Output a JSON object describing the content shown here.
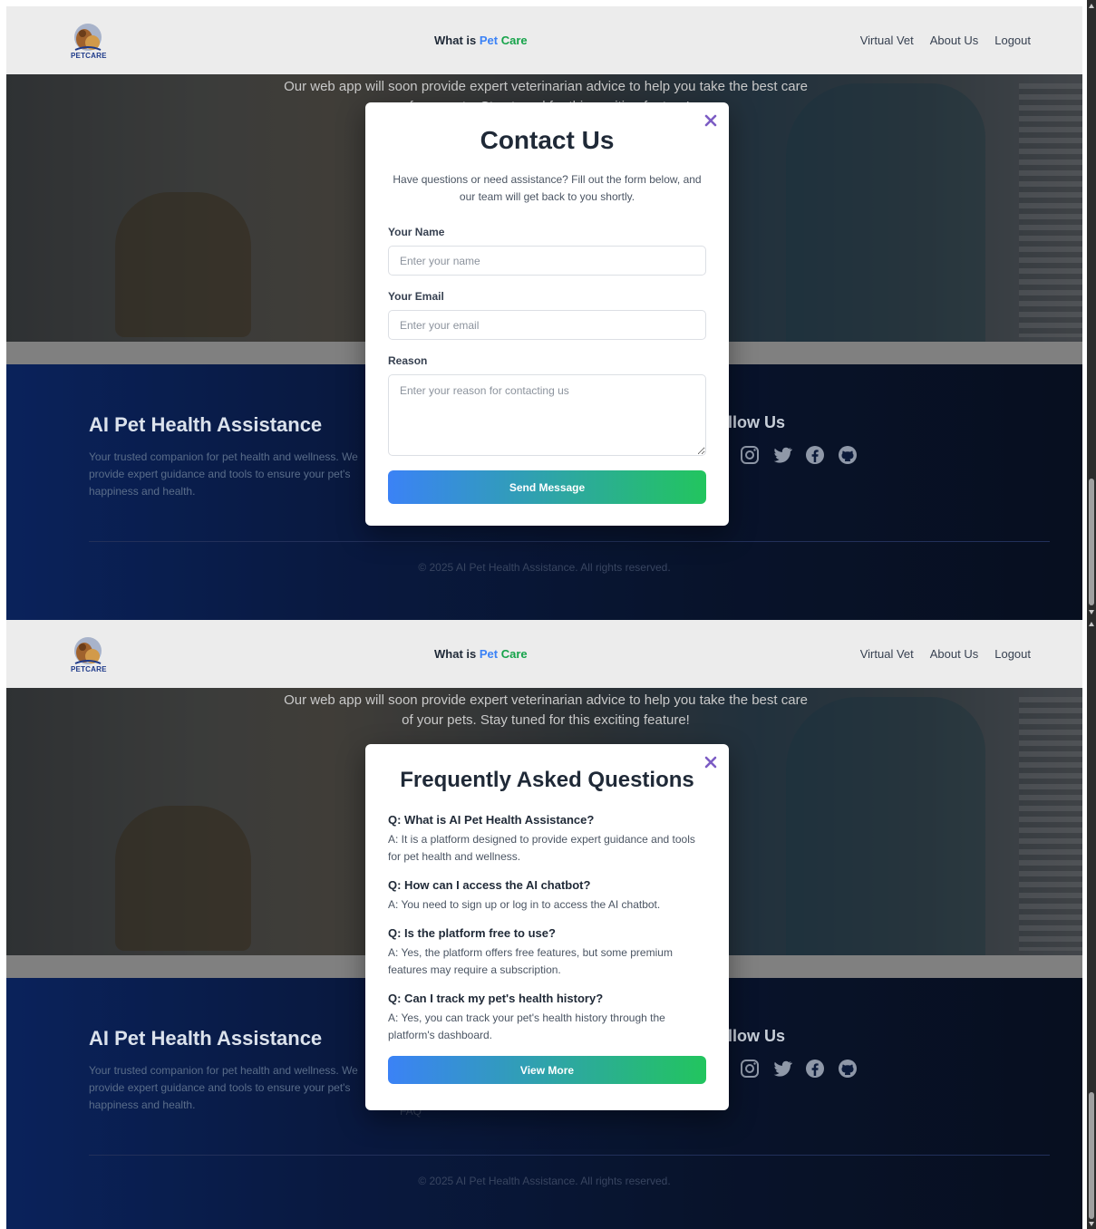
{
  "nav": {
    "logo_text": "PETCARE",
    "center_prefix": "What is ",
    "center_accent": "Pet",
    "center_accent2": "Care",
    "links": [
      "Virtual Vet",
      "About Us",
      "Logout"
    ]
  },
  "hero": {
    "text": "Our web app will soon provide expert veterinarian advice to help you take the best care of your pets. Stay tuned for this exciting feature!"
  },
  "footer": {
    "title": "AI Pet Health Assistance",
    "desc": "Your trusted companion for pet health and wellness. We provide expert guidance and tools to ensure your pet's happiness and health.",
    "follow": "llow Us",
    "faq_link": "FAQ",
    "copyright": "© 2025 AI Pet Health Assistance. All rights reserved.",
    "icons": [
      "instagram-icon",
      "twitter-icon",
      "facebook-icon",
      "github-icon"
    ]
  },
  "contact": {
    "title": "Contact Us",
    "subtitle": "Have questions or need assistance? Fill out the form below, and our team will get back to you shortly.",
    "name_label": "Your Name",
    "name_placeholder": "Enter your name",
    "email_label": "Your Email",
    "email_placeholder": "Enter your email",
    "reason_label": "Reason",
    "reason_placeholder": "Enter your reason for contacting us",
    "send_label": "Send Message"
  },
  "faq": {
    "title": "Frequently Asked Questions",
    "items": [
      {
        "q": "Q: What is AI Pet Health Assistance?",
        "a": "A: It is a platform designed to provide expert guidance and tools for pet health and wellness."
      },
      {
        "q": "Q: How can I access the AI chatbot?",
        "a": "A: You need to sign up or log in to access the AI chatbot."
      },
      {
        "q": "Q: Is the platform free to use?",
        "a": "A: Yes, the platform offers free features, but some premium features may require a subscription."
      },
      {
        "q": "Q: Can I track my pet's health history?",
        "a": "A: Yes, you can track your pet's health history through the platform's dashboard."
      }
    ],
    "view_more": "View More"
  },
  "colors": {
    "accent_blue": "#3b82f6",
    "accent_green": "#22c55e",
    "close_purple": "#7c5cc4"
  }
}
